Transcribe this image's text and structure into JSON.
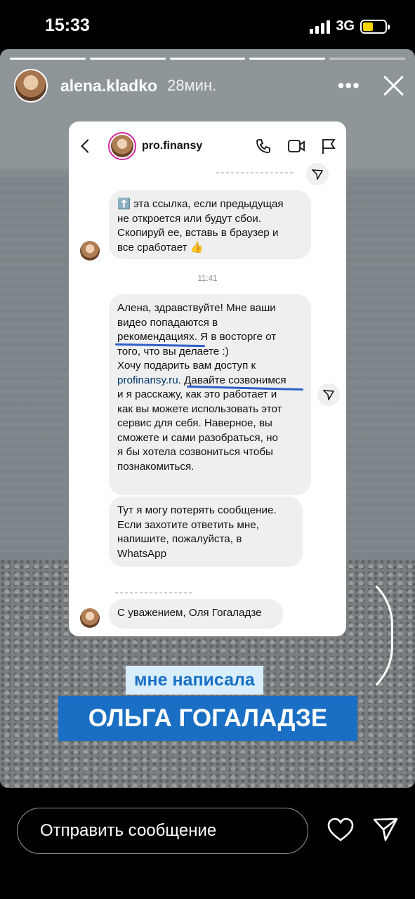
{
  "status": {
    "time": "15:33",
    "network": "3G"
  },
  "story": {
    "username": "alena.kladko",
    "time_ago": "28мин.",
    "progress_total": 5,
    "progress_done": 4
  },
  "dm": {
    "name": "pro.finansy",
    "msg1": [
      "⬆️ эта ссылка, если предыдущая",
      "не откроется или будут сбои.",
      "Скопируй ее, вставь в браузер и",
      "все сработает 👍"
    ],
    "timestamp": "11:41",
    "msg2_lines": [
      "Алена, здравствуйте! Мне ваши",
      "видео попадаются в",
      "рекомендациях. Я в восторге от",
      "того, что вы делаете :)",
      "Хочу подарить вам доступ к"
    ],
    "msg2_link": "profinansy.ru",
    "msg2_link_tail": ". Давайте созвонимся",
    "msg2_lines_b": [
      "и я расскажу, как это работает и",
      "как вы можете использовать этот",
      "сервис для себя. Наверное, вы",
      "сможете и сами разобраться, но",
      "я бы хотела созвониться чтобы",
      "познакомиться."
    ],
    "msg3": [
      "Тут я могу потерять сообщение.",
      "Если захотите ответить мне,",
      "напишите, пожалуйста, в",
      "WhatsApp"
    ],
    "msg4": "С уважением, Оля Гогаладзе"
  },
  "labels": {
    "small": "мне написала",
    "big": "ОЛЬГА ГОГАЛАДЗЕ"
  },
  "reply": {
    "placeholder": "Отправить сообщение"
  },
  "colors": {
    "accent_blue": "#1a6fc4",
    "label_bg": "#d8eefc"
  }
}
